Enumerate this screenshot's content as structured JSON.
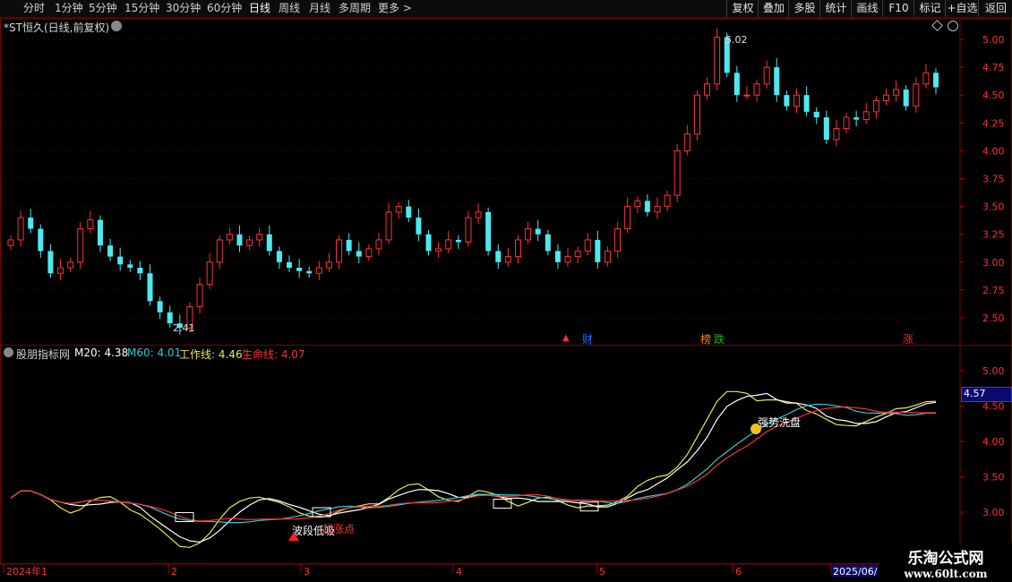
{
  "toolbar": {
    "periods": [
      "分时",
      "1分钟",
      "5分钟",
      "15分钟",
      "30分钟",
      "60分钟",
      "日线",
      "周线",
      "月线",
      "多周期",
      "更多 >"
    ],
    "active_period": "日线",
    "right_buttons": [
      "复权",
      "叠加",
      "多股",
      "统计",
      "画线",
      "F10",
      "标记",
      "+自选",
      "返回"
    ]
  },
  "main_chart": {
    "title": "*ST恒久(日线,前复权)",
    "y_ticks": [
      "5.00",
      "4.75",
      "4.50",
      "4.25",
      "4.00",
      "3.75",
      "3.50",
      "3.25",
      "3.00",
      "2.75",
      "2.50"
    ],
    "high_label": "5.02",
    "low_label": "2.41",
    "events": [
      {
        "text": "▲",
        "color": "#ff3030"
      },
      {
        "text": "财",
        "color": "#1e6cff"
      },
      {
        "text": "榜",
        "color": "#ff8800"
      },
      {
        "text": "跌",
        "color": "#00c000"
      },
      {
        "text": "涨",
        "color": "#ff2020"
      }
    ]
  },
  "indicator": {
    "name": "股朋指标网",
    "items": [
      {
        "label": "M20: 4.38",
        "color": "#ffffff"
      },
      {
        "label": "M60: 4.01",
        "color": "#2ec8d8"
      },
      {
        "label": "工作线: 4.46",
        "color": "#e8e84a"
      },
      {
        "label": "生命线: 4.07",
        "color": "#ff3030"
      }
    ],
    "y_ticks": [
      "5.00",
      "4.50",
      "4.00",
      "3.50",
      "3.00"
    ],
    "current_value": "4.57",
    "annotations": [
      "强势洗盘",
      "波段低吸",
      "起涨点"
    ]
  },
  "x_axis": {
    "labels": [
      "2024年1",
      "2",
      "3",
      "4",
      "5",
      "6",
      "2025/06/"
    ]
  },
  "watermark": {
    "line1": "乐淘公式网",
    "line2": "www.60lt.com"
  },
  "colors": {
    "up": "#ff3333",
    "down": "#4de8f0",
    "frame": "#7a0000",
    "axis_text": "#ff3030"
  },
  "chart_data": {
    "type": "candlestick",
    "title": "*ST恒久(日线,前复权)",
    "series": [
      {
        "name": "M20",
        "color": "#ffffff",
        "last": 4.38
      },
      {
        "name": "M60",
        "color": "#2ec8d8",
        "last": 4.01
      },
      {
        "name": "工作线",
        "color": "#e8e84a",
        "last": 4.46
      },
      {
        "name": "生命线",
        "color": "#ff3030",
        "last": 4.07
      }
    ],
    "close": [
      3.2,
      3.4,
      3.3,
      3.1,
      2.9,
      2.95,
      3.0,
      3.3,
      3.38,
      3.15,
      3.05,
      2.98,
      2.95,
      2.9,
      2.65,
      2.55,
      2.45,
      2.41,
      2.6,
      2.8,
      3.0,
      3.2,
      3.25,
      3.15,
      3.2,
      3.25,
      3.1,
      3.0,
      2.95,
      2.92,
      2.9,
      2.95,
      3.0,
      3.2,
      3.1,
      3.05,
      3.12,
      3.2,
      3.45,
      3.5,
      3.4,
      3.25,
      3.1,
      3.12,
      3.2,
      3.18,
      3.4,
      3.45,
      3.1,
      3.0,
      3.05,
      3.2,
      3.3,
      3.25,
      3.1,
      3.0,
      3.05,
      3.1,
      3.2,
      3.0,
      3.1,
      3.3,
      3.5,
      3.55,
      3.45,
      3.5,
      3.6,
      4.0,
      4.15,
      4.5,
      4.6,
      5.02,
      4.7,
      4.5,
      4.5,
      4.6,
      4.75,
      4.5,
      4.4,
      4.5,
      4.35,
      4.3,
      4.1,
      4.2,
      4.3,
      4.28,
      4.35,
      4.45,
      4.5,
      4.55,
      4.4,
      4.6,
      4.7,
      4.57
    ],
    "ylim": [
      2.4,
      5.1
    ],
    "x_labels": [
      "2024年1",
      "2",
      "3",
      "4",
      "5",
      "6",
      "2025/06/"
    ]
  }
}
